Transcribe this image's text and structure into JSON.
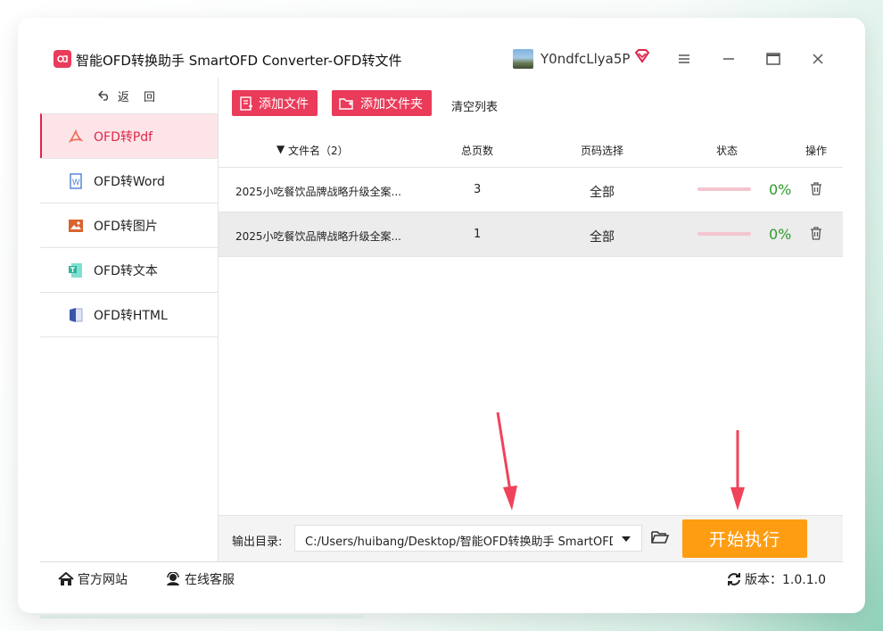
{
  "window": {
    "title": "智能OFD转换助手 SmartOFD Converter-OFD转文件",
    "user_name": "Y0ndfcLlya5P",
    "controls": [
      "menu-icon",
      "minimize-icon",
      "maximize-icon",
      "close-icon"
    ]
  },
  "sidebar": {
    "back_label": "返 回",
    "items": [
      {
        "label": "OFD转Pdf",
        "icon": "pdf-icon",
        "active": true
      },
      {
        "label": "OFD转Word",
        "icon": "word-icon",
        "active": false
      },
      {
        "label": "OFD转图片",
        "icon": "image-icon",
        "active": false
      },
      {
        "label": "OFD转文本",
        "icon": "text-icon",
        "active": false
      },
      {
        "label": "OFD转HTML",
        "icon": "html-icon",
        "active": false
      }
    ]
  },
  "toolbar": {
    "add_file": "添加文件",
    "add_folder": "添加文件夹",
    "clear_list": "清空列表"
  },
  "table": {
    "headers": {
      "filename": "文件名（2）",
      "pages": "总页数",
      "range": "页码选择",
      "status": "状态",
      "action": "操作"
    },
    "rows": [
      {
        "filename": "2025小吃餐饮品牌战略升级全案...",
        "pages": "3",
        "range": "全部",
        "progress_pct": "0%",
        "progress": 0
      },
      {
        "filename": "2025小吃餐饮品牌战略升级全案...",
        "pages": "1",
        "range": "全部",
        "progress_pct": "0%",
        "progress": 0
      }
    ]
  },
  "output": {
    "label": "输出目录:",
    "path": "C:/Users/huibang/Desktop/智能OFD转换助手 SmartOFD Converter",
    "start_label": "开始执行"
  },
  "statusbar": {
    "website": "官方网站",
    "support": "在线客服",
    "version": "版本：1.0.1.0"
  },
  "colors": {
    "accent": "#ea3b5a",
    "start": "#ff9d12",
    "progress_text": "#2e9b2e",
    "active_bg": "#fde4e8"
  }
}
